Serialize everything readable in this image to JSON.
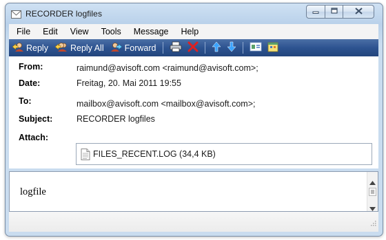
{
  "window": {
    "title": "RECORDER logfiles",
    "title_icon": "envelope-icon",
    "controls": {
      "minimize_icon": "minimize-icon",
      "maximize_icon": "maximize-icon",
      "close_icon": "close-icon"
    }
  },
  "menu": {
    "items": [
      "File",
      "Edit",
      "View",
      "Tools",
      "Message",
      "Help"
    ]
  },
  "toolbar": {
    "reply_label": "Reply",
    "reply_all_label": "Reply All",
    "forward_label": "Forward",
    "icons": [
      "reply-icon",
      "reply-all-icon",
      "forward-icon",
      "print-icon",
      "delete-icon",
      "previous-icon",
      "next-icon",
      "address-book-icon",
      "calendar-icon"
    ]
  },
  "header": {
    "from_label": "From:",
    "from_value": "raimund@avisoft.com <raimund@avisoft.com>;",
    "date_label": "Date:",
    "date_value": "Freitag, 20. Mai 2011 19:55",
    "to_label": "To:",
    "to_value": "mailbox@avisoft.com <mailbox@avisoft.com>;",
    "subject_label": "Subject:",
    "subject_value": "RECORDER logfiles",
    "attach_label": "Attach:",
    "attachment": "FILES_RECENT.LOG (34,4 KB)"
  },
  "body": {
    "text": "logfile"
  },
  "colors": {
    "toolbar": "#2d5390",
    "frame": "#b9d1ea",
    "delete_red": "#e02020",
    "arrow_blue": "#3aa3ff"
  }
}
